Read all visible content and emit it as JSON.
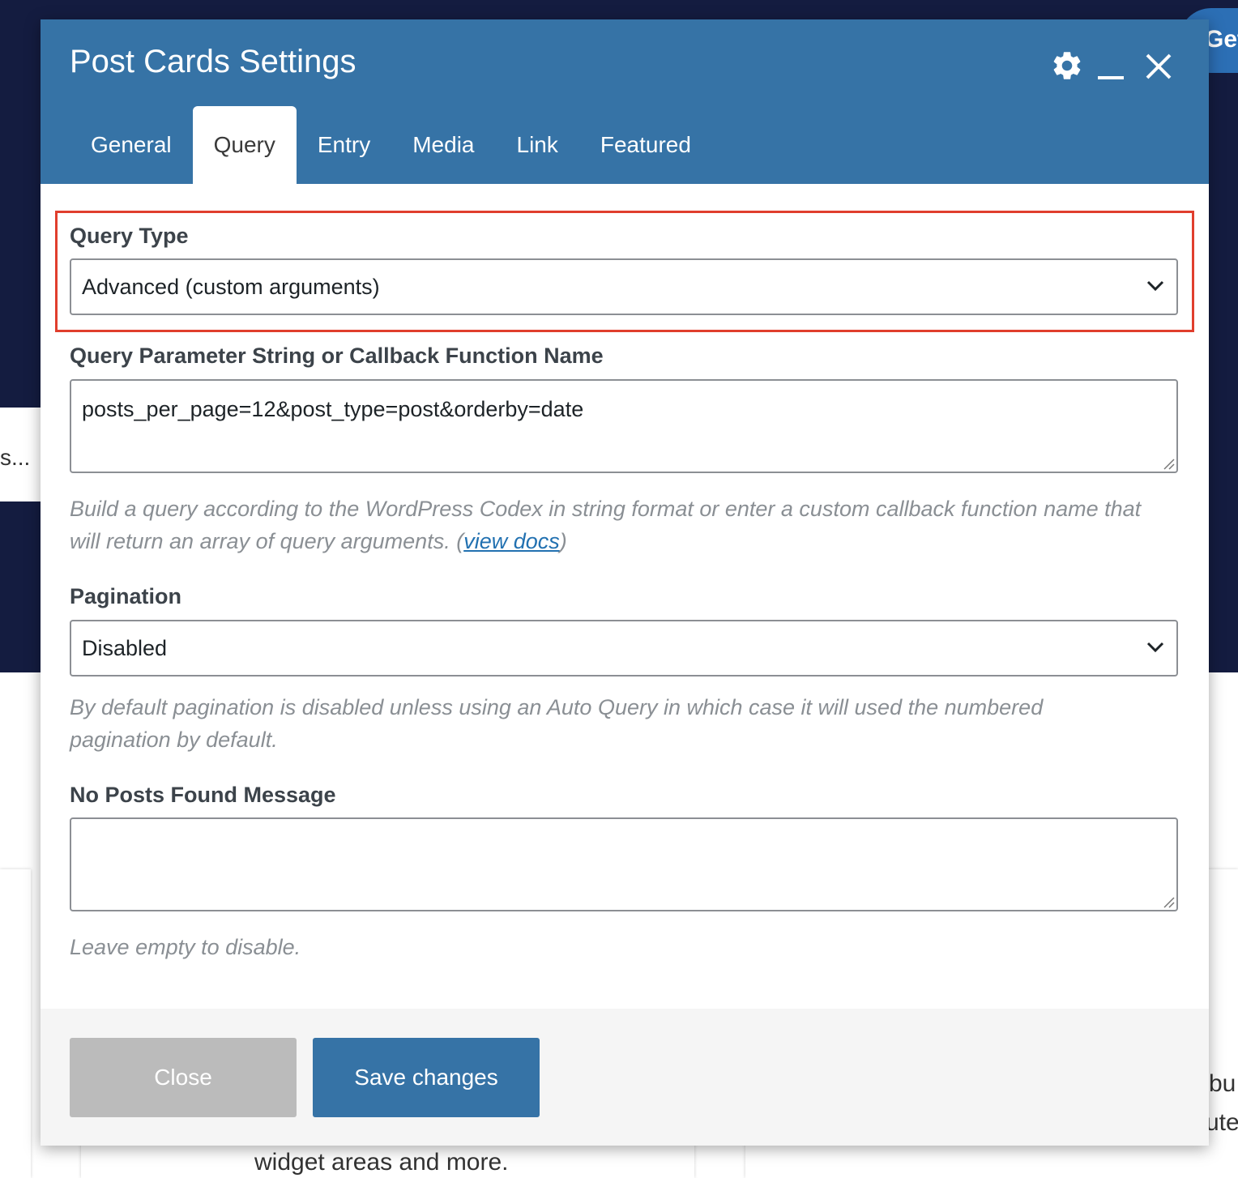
{
  "background": {
    "left_card_text": "s...",
    "get_button_label": "Get",
    "bottom_card_text": "widget areas and more.",
    "right_card_text_1": "bu",
    "right_card_text_2": "ute"
  },
  "modal": {
    "title": "Post Cards Settings",
    "header_icons": [
      "gear-icon",
      "minimize-icon",
      "close-icon"
    ]
  },
  "tabs": [
    {
      "label": "General",
      "active": false
    },
    {
      "label": "Query",
      "active": true
    },
    {
      "label": "Entry",
      "active": false
    },
    {
      "label": "Media",
      "active": false
    },
    {
      "label": "Link",
      "active": false
    },
    {
      "label": "Featured",
      "active": false
    }
  ],
  "fields": {
    "query_type": {
      "label": "Query Type",
      "value": "Advanced (custom arguments)"
    },
    "query_params": {
      "label": "Query Parameter String or Callback Function Name",
      "value": "posts_per_page=12&post_type=post&orderby=date",
      "help": "Build a query according to the WordPress Codex in string format or enter a custom callback function name that will return an array of query arguments. (",
      "help_link": "view docs",
      "help_end": ")"
    },
    "pagination": {
      "label": "Pagination",
      "value": "Disabled",
      "help": "By default pagination is disabled unless using an Auto Query in which case it will used the numbered pagination by default."
    },
    "no_posts_message": {
      "label": "No Posts Found Message",
      "value": "",
      "help": "Leave empty to disable."
    }
  },
  "footer": {
    "close_label": "Close",
    "save_label": "Save changes"
  },
  "colors": {
    "header_bg": "#3673a6",
    "highlight_border": "#e03e2d",
    "close_button_bg": "#bbbbbb",
    "save_button_bg": "#3673a6",
    "page_bg_dark": "#141c40"
  }
}
